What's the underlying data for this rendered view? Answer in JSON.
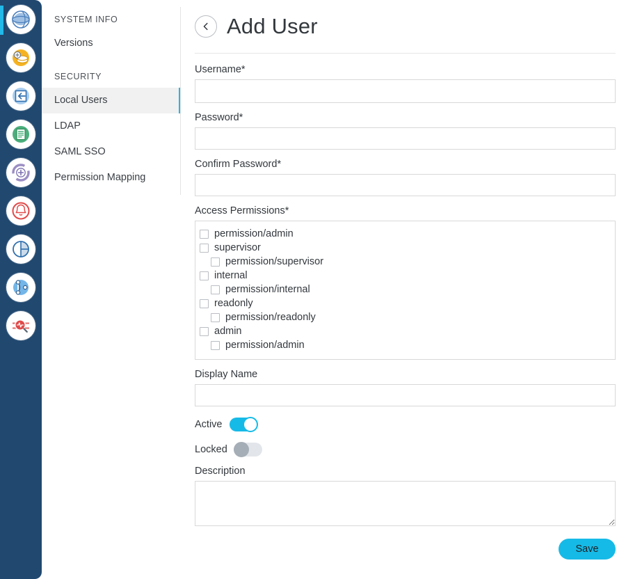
{
  "rail": {
    "icons": [
      {
        "name": "dashboard-globe-icon",
        "active": true
      },
      {
        "name": "coins-add-icon",
        "active": false
      },
      {
        "name": "login-arrow-icon",
        "active": false
      },
      {
        "name": "document-list-icon",
        "active": false
      },
      {
        "name": "spinner-add-icon",
        "active": false
      },
      {
        "name": "bell-alert-icon",
        "active": false
      },
      {
        "name": "contrast-circle-icon",
        "active": false
      },
      {
        "name": "node-graph-icon",
        "active": false
      },
      {
        "name": "pulse-search-icon",
        "active": false
      }
    ]
  },
  "sidebar": {
    "group_system_label": "SYSTEM INFO",
    "group_security_label": "SECURITY",
    "system_items": [
      {
        "label": "Versions",
        "selected": false
      }
    ],
    "security_items": [
      {
        "label": "Local Users",
        "selected": true
      },
      {
        "label": "LDAP",
        "selected": false
      },
      {
        "label": "SAML SSO",
        "selected": false
      },
      {
        "label": "Permission Mapping",
        "selected": false
      }
    ]
  },
  "header": {
    "back_icon": "chevron-left-icon",
    "title": "Add User"
  },
  "form": {
    "username": {
      "label": "Username*",
      "value": "",
      "placeholder": ""
    },
    "password": {
      "label": "Password*",
      "value": "",
      "placeholder": ""
    },
    "confirm_password": {
      "label": "Confirm Password*",
      "value": "",
      "placeholder": ""
    },
    "access_permissions": {
      "label": "Access Permissions*",
      "items": [
        {
          "label": "permission/admin",
          "checked": false,
          "child": false
        },
        {
          "label": "supervisor",
          "checked": false,
          "child": false
        },
        {
          "label": "permission/supervisor",
          "checked": false,
          "child": true
        },
        {
          "label": "internal",
          "checked": false,
          "child": false
        },
        {
          "label": "permission/internal",
          "checked": false,
          "child": true
        },
        {
          "label": "readonly",
          "checked": false,
          "child": false
        },
        {
          "label": "permission/readonly",
          "checked": false,
          "child": true
        },
        {
          "label": "admin",
          "checked": false,
          "child": false
        },
        {
          "label": "permission/admin",
          "checked": false,
          "child": true
        }
      ]
    },
    "display_name": {
      "label": "Display Name",
      "value": "",
      "placeholder": ""
    },
    "active": {
      "label": "Active",
      "state": "on"
    },
    "locked": {
      "label": "Locked",
      "state": "off"
    },
    "description": {
      "label": "Description",
      "value": "",
      "placeholder": ""
    },
    "save_label": "Save"
  },
  "colors": {
    "rail_background": "#21486f",
    "accent_cyan": "#22b8e8",
    "toggle_on": "#16bae7",
    "toggle_off": "#e2e6ea",
    "selected_nav_background": "#f1f1f1",
    "text_primary": "#33383d",
    "border": "#d8d8d8"
  }
}
